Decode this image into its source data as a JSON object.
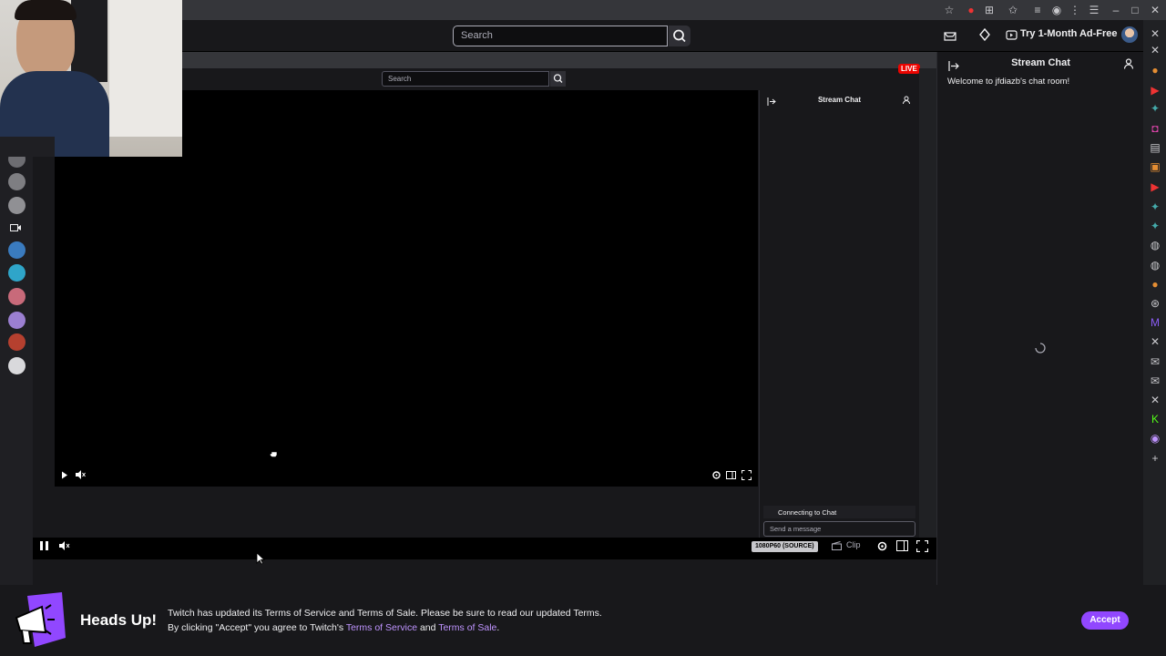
{
  "topnav": {
    "search_placeholder": "Search",
    "try_adfree": "Try 1-Month Ad-Free"
  },
  "inner": {
    "search_placeholder": "Search",
    "live_badge": "LIVE",
    "chat_title": "Stream Chat",
    "connecting": "Connecting to Chat",
    "send_placeholder": "Send a message"
  },
  "player": {
    "quality": "1080P60 (SOURCE)",
    "clip": "Clip"
  },
  "chat": {
    "title": "Stream Chat",
    "welcome": "Welcome to jfdiazb's chat room!"
  },
  "banner": {
    "title": "Heads Up!",
    "line1": "Twitch has updated its Terms of Service and Terms of Sale. Please be sure to read our updated Terms.",
    "line2_prefix": "By clicking \"Accept\" you agree to Twitch's ",
    "tos_link": "Terms of Service",
    "and": " and ",
    "tos_sale_link": "Terms of Sale",
    "period": ".",
    "accept": "Accept"
  },
  "colors": {
    "accent": "#9147ff",
    "link": "#bf94ff",
    "live": "#eb0400"
  },
  "browser_icons": [
    "star-icon",
    "extension-badge-icon",
    "puzzle-icon",
    "bookmark-star-icon",
    "media-icon",
    "profile-icon",
    "menu-icon",
    "sidebar-icon"
  ],
  "sidebar_channels": [
    "channel-1",
    "channel-2",
    "channel-3",
    "channel-4",
    "video-icon",
    "channel-5",
    "channel-6",
    "channel-7",
    "channel-8",
    "channel-9",
    "channel-10"
  ]
}
